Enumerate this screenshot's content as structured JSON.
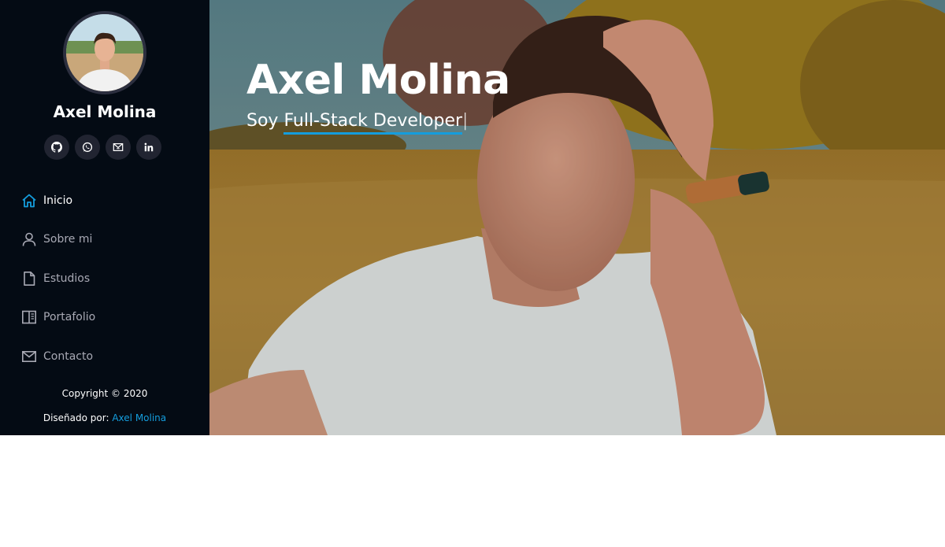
{
  "profile": {
    "name": "Axel Molina"
  },
  "social": [
    {
      "icon": "github-icon",
      "glyph": "G"
    },
    {
      "icon": "whatsapp-icon",
      "glyph": "W"
    },
    {
      "icon": "mail-icon",
      "glyph": "M"
    },
    {
      "icon": "linkedin-icon",
      "glyph": "in"
    }
  ],
  "nav": {
    "items": [
      {
        "label": "Inicio",
        "icon": "home-icon",
        "active": true
      },
      {
        "label": "Sobre mi",
        "icon": "person-icon",
        "active": false
      },
      {
        "label": "Estudios",
        "icon": "file-icon",
        "active": false
      },
      {
        "label": "Portafolio",
        "icon": "book-icon",
        "active": false
      },
      {
        "label": "Contacto",
        "icon": "envelope-icon",
        "active": false
      }
    ]
  },
  "footer": {
    "copyright": "Copyright © 2020",
    "designed_prefix": "Diseñado por:",
    "designed_author": "Axel Molina"
  },
  "hero": {
    "title": "Axel Molina",
    "subtitle_prefix": "Soy ",
    "subtitle_typed": "Full-Stack Developer",
    "cursor": "|"
  },
  "colors": {
    "accent": "#149ddd",
    "sidebar_bg": "#040b14",
    "nav_text": "#a8a9b4",
    "social_bg": "#212431"
  }
}
